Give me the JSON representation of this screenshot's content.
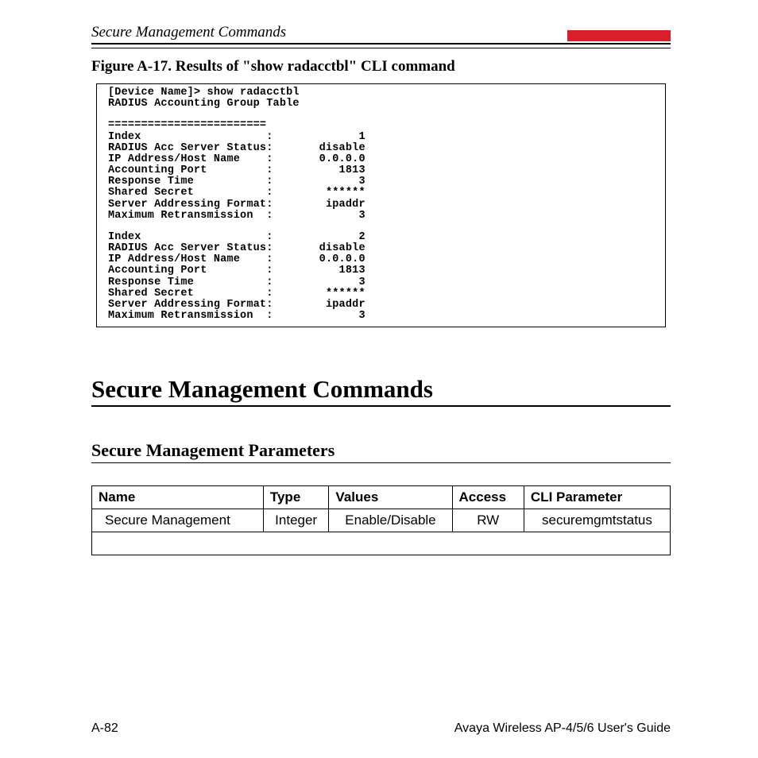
{
  "header": {
    "title": "Secure Management Commands"
  },
  "figure": {
    "caption": "Figure A-17.    Results of \"show radacctbl\" CLI command"
  },
  "cli": {
    "prompt": "[Device Name]> show radacctbl",
    "subtitle": "RADIUS Accounting Group Table",
    "divider": "========================",
    "entries": [
      {
        "index_label": "Index",
        "index": "1",
        "status_label": "RADIUS Acc Server Status",
        "status": "disable",
        "ip_label": "IP Address/Host Name",
        "ip": "0.0.0.0",
        "port_label": "Accounting Port",
        "port": "1813",
        "resp_label": "Response Time",
        "resp": "3",
        "secret_label": "Shared Secret",
        "secret": "******",
        "fmt_label": "Server Addressing Format",
        "fmt": "ipaddr",
        "retx_label": "Maximum Retransmission",
        "retx": "3"
      },
      {
        "index_label": "Index",
        "index": "2",
        "status_label": "RADIUS Acc Server Status",
        "status": "disable",
        "ip_label": "IP Address/Host Name",
        "ip": "0.0.0.0",
        "port_label": "Accounting Port",
        "port": "1813",
        "resp_label": "Response Time",
        "resp": "3",
        "secret_label": "Shared Secret",
        "secret": "******",
        "fmt_label": "Server Addressing Format",
        "fmt": "ipaddr",
        "retx_label": "Maximum Retransmission",
        "retx": "3"
      }
    ]
  },
  "section": {
    "h1": "Secure Management Commands",
    "h2": "Secure Management Parameters"
  },
  "table": {
    "headers": {
      "name": "Name",
      "type": "Type",
      "values": "Values",
      "access": "Access",
      "cli": "CLI Parameter"
    },
    "row": {
      "name": "Secure Management",
      "type": "Integer",
      "values": "Enable/Disable",
      "access": "RW",
      "cli": "securemgmtstatus"
    }
  },
  "footer": {
    "left": "A-82",
    "right": "Avaya Wireless AP-4/5/6 User's Guide"
  }
}
